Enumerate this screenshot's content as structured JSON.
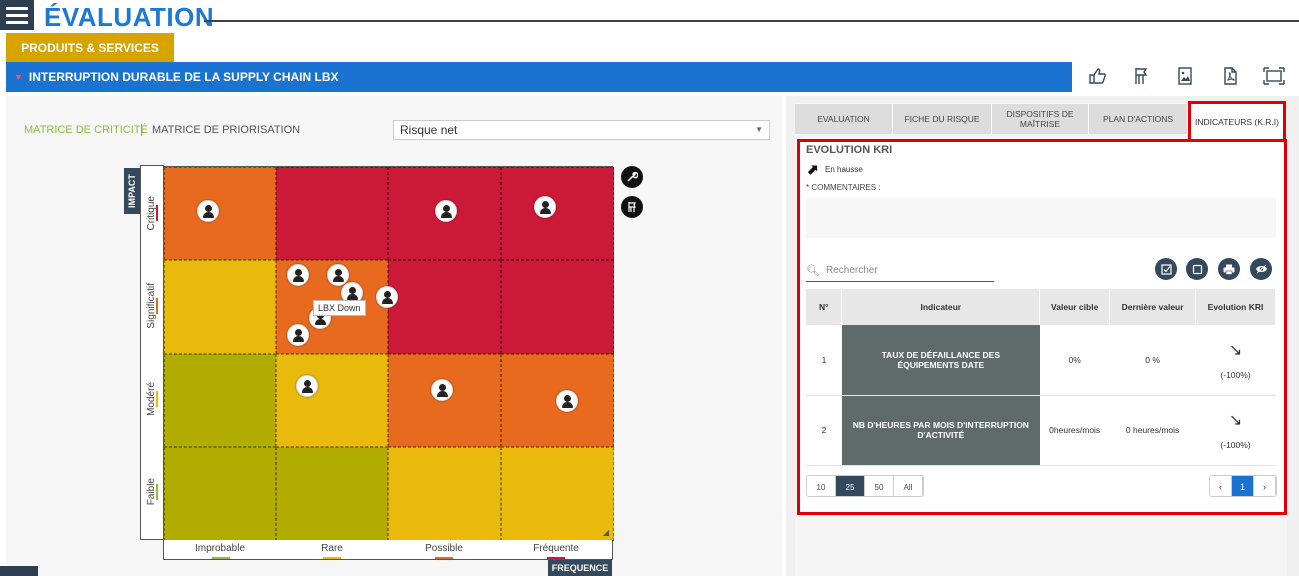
{
  "header": {
    "app_title": "ÉVALUATION"
  },
  "category_tab": "PRODUITS & SERVICES",
  "risk_title": "INTERRUPTION DURABLE DE LA SUPPLY CHAIN LBX",
  "top_icons": [
    "thumb-icon",
    "flag-icon",
    "image-icon",
    "pdf-icon",
    "fullscreen-icon"
  ],
  "matrix_panel": {
    "tabs": [
      "MATRICE DE CRITICITÉ",
      "MATRICE DE PRIORISATION"
    ],
    "select_value": "Risque net",
    "impact_label": "IMPACT",
    "frequency_label": "FREQUENCE",
    "y_levels": [
      "Critique",
      "Significatif",
      "Modéré",
      "Faible"
    ],
    "x_levels": [
      "Improbable",
      "Rare",
      "Possible",
      "Fréquente"
    ],
    "tooltip": "LBX Down",
    "colors": {
      "red": "#cc1937",
      "orange": "#e86a1f",
      "yellow": "#e9b90b",
      "olive": "#b2ab00"
    }
  },
  "right_panel": {
    "tabs": [
      "EVALUATION",
      "FICHE DU RISQUE",
      "DISPOSITIFS DE MAÎTRISE",
      "PLAN D'ACTIONS",
      "INDICATEURS (K.R.I)"
    ],
    "kri_title": "EVOLUTION KRI",
    "trend_label": "En hausse",
    "comments_label": "COMMENTAIRES :",
    "search_placeholder": "Rechercher",
    "table": {
      "headers": [
        "N°",
        "Indicateur",
        "Valeur cible",
        "Dernière valeur",
        "Evolution KRI"
      ],
      "rows": [
        {
          "num": "1",
          "indicator": "TAUX DE DÉFAILLANCE DES ÉQUIPEMENTS DATE",
          "target": "0%",
          "last": "0 %",
          "evolution": "(-100%)"
        },
        {
          "num": "2",
          "indicator": "NB D'HEURES PAR MOIS D'INTERRUPTION D'ACTIVITÉ",
          "target": "0heures/mois",
          "last": "0 heures/mois",
          "evolution": "(-100%)"
        }
      ]
    },
    "page_sizes": [
      "10",
      "25",
      "50",
      "All"
    ],
    "current_page": "1"
  }
}
